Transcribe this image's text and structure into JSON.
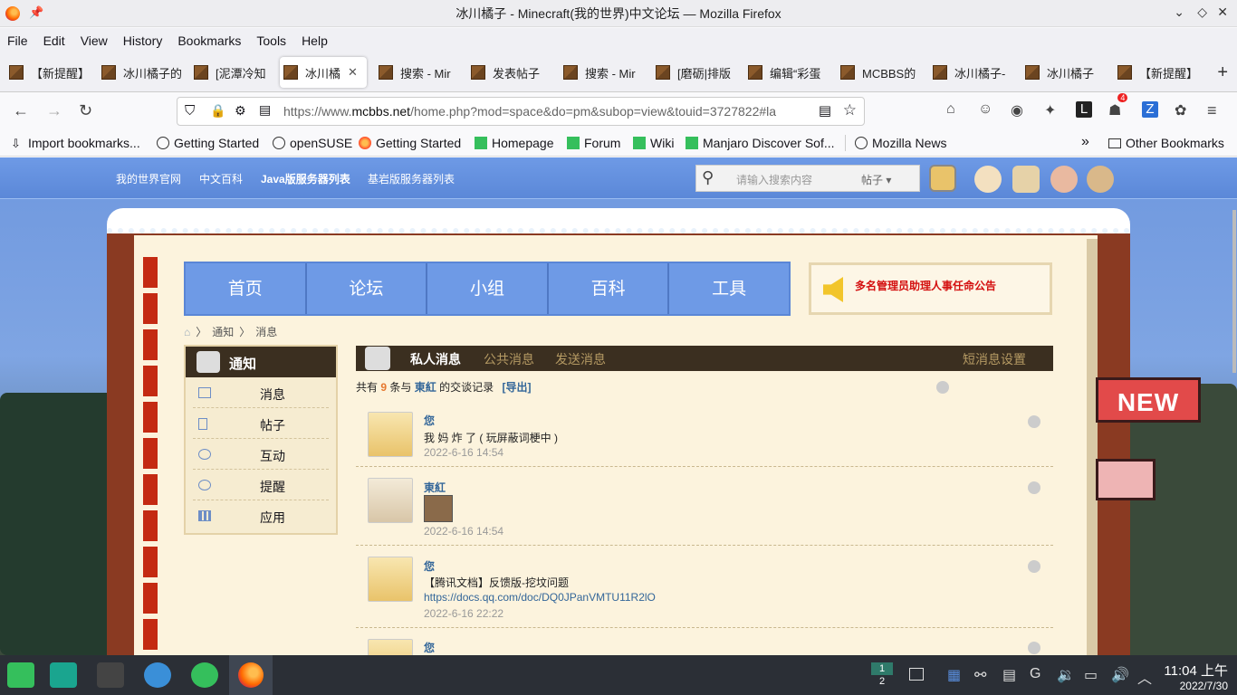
{
  "window": {
    "title": "冰川橘子 - Minecraft(我的世界)中文论坛 — Mozilla Firefox"
  },
  "menu": [
    "File",
    "Edit",
    "View",
    "History",
    "Bookmarks",
    "Tools",
    "Help"
  ],
  "tabs": [
    "【新提醒】",
    "冰川橘子的",
    "[泥潭冷知",
    "冰川橘",
    "搜索 - Mir",
    "发表帖子",
    "搜索 - Mir",
    "[磨砺|排版",
    "编辑“彩蛋",
    "MCBBS的",
    "冰川橘子-",
    "冰川橘子",
    "【新提醒】"
  ],
  "urlbar": {
    "prefix": "https://www.",
    "domain": "mcbbs.net",
    "rest": "/home.php?mod=space&do=pm&subop=view&touid=3727822#la"
  },
  "extensions": {
    "badge_count": "4"
  },
  "bookmarks": [
    "Import bookmarks...",
    "Getting Started",
    "openSUSE",
    "Getting Started",
    "Homepage",
    "Forum",
    "Wiki",
    "Manjaro Discover Sof...",
    "Mozilla News"
  ],
  "bookmarks_other": "Other Bookmarks",
  "site": {
    "toplinks": [
      "我的世界官网",
      "中文百科",
      "Java版服务器列表",
      "基岩版服务器列表"
    ],
    "search": {
      "placeholder": "请输入搜索内容",
      "scope": "帖子"
    },
    "mainnav": [
      "首页",
      "论坛",
      "小组",
      "百科",
      "工具"
    ],
    "notice": "多名管理员助理人事任命公告",
    "breadcrumb": [
      "通知",
      "消息"
    ],
    "sidebar": {
      "title": "通知",
      "items": [
        "消息",
        "帖子",
        "互动",
        "提醒",
        "应用"
      ]
    },
    "msgtabs": {
      "private": "私人消息",
      "public": "公共消息",
      "send": "发送消息",
      "settings": "短消息设置"
    },
    "summary": {
      "prefix": "共有",
      "count": "9",
      "mid": "条与",
      "user": "東紅",
      "suffix": "的交谈记录",
      "export": "[导出]"
    },
    "messages": [
      {
        "who": "您",
        "text": "我 妈 炸 了 ( 玩屏蔽词梗中 )",
        "time": "2022-6-16 14:54"
      },
      {
        "who": "東紅",
        "text": "",
        "time": "2022-6-16 14:54"
      },
      {
        "who": "您",
        "text": "【腾讯文档】反馈版-挖坟问题",
        "link": "https://docs.qq.com/doc/DQ0JPanVMTU11R2lO",
        "time": "2022-6-16 22:22"
      },
      {
        "who": "您"
      }
    ],
    "side_tag": "NEW"
  },
  "taskbar": {
    "pager": [
      "1",
      "2"
    ],
    "time": "11:04 上午",
    "date": "2022/7/30"
  },
  "colors": {
    "nav_blue": "#6e9ae6",
    "frame": "#8a3a22",
    "paper": "#fcf3dd",
    "accent_red": "#d41010"
  }
}
